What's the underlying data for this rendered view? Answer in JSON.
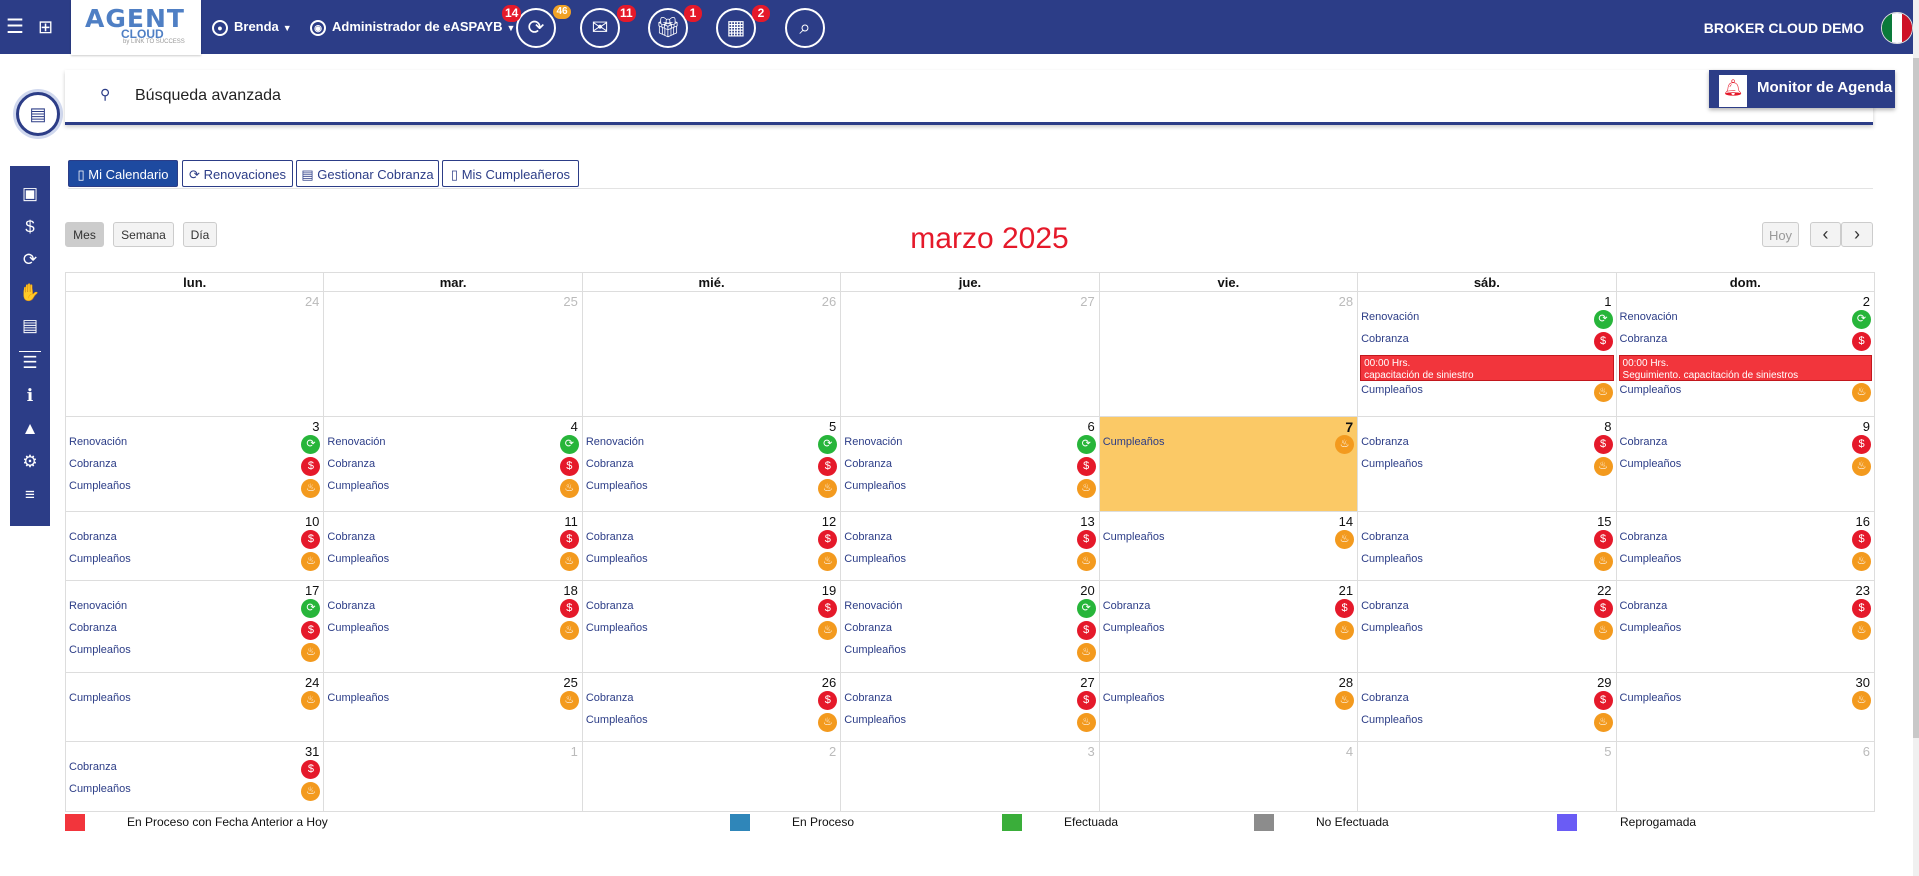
{
  "header": {
    "logo_main": "AGENT",
    "logo_sub": "CLOUD",
    "logo_tag": "by LINK TO SUCCESS",
    "user": "Brenda",
    "role": "Administrador de eASPAYB",
    "badges": {
      "contacts": "14",
      "contacts_secondary": "46",
      "mail": "11",
      "gifts": "1",
      "calendar": "2"
    },
    "brand": "BROKER CLOUD DEMO"
  },
  "search": {
    "placeholder": "Búsqueda avanzada"
  },
  "monitor": {
    "label": "Monitor de Agenda"
  },
  "tabs": [
    "Mi Calendario",
    "Renovaciones",
    "Gestionar Cobranza",
    "Mis Cumpleañeros"
  ],
  "views": [
    "Mes",
    "Semana",
    "Día"
  ],
  "nav": {
    "today": "Hoy",
    "prev": "‹",
    "next": "›"
  },
  "calendar": {
    "title": "marzo 2025",
    "weekdays": [
      "lun.",
      "mar.",
      "mié.",
      "jue.",
      "vie.",
      "sáb.",
      "dom."
    ],
    "weeks": [
      [
        {
          "day": "24",
          "off": true,
          "events": []
        },
        {
          "day": "25",
          "off": true,
          "events": []
        },
        {
          "day": "26",
          "off": true,
          "events": []
        },
        {
          "day": "27",
          "off": true,
          "events": []
        },
        {
          "day": "28",
          "off": true,
          "events": []
        },
        {
          "day": "1",
          "events": [
            {
              "t": "Renovación",
              "k": "ren"
            },
            {
              "t": "Cobranza",
              "k": "cob"
            },
            {
              "appt": [
                "00:00 Hrs.",
                "capacitación de siniestro"
              ]
            },
            {
              "t": "Cumpleaños",
              "k": "cum"
            }
          ]
        },
        {
          "day": "2",
          "events": [
            {
              "t": "Renovación",
              "k": "ren"
            },
            {
              "t": "Cobranza",
              "k": "cob"
            },
            {
              "appt": [
                "00:00 Hrs.",
                "Seguimiento. capacitación de siniestros"
              ]
            },
            {
              "t": "Cumpleaños",
              "k": "cum"
            }
          ]
        }
      ],
      [
        {
          "day": "3",
          "events": [
            {
              "t": "Renovación",
              "k": "ren"
            },
            {
              "t": "Cobranza",
              "k": "cob"
            },
            {
              "t": "Cumpleaños",
              "k": "cum"
            }
          ]
        },
        {
          "day": "4",
          "events": [
            {
              "t": "Renovación",
              "k": "ren"
            },
            {
              "t": "Cobranza",
              "k": "cob"
            },
            {
              "t": "Cumpleaños",
              "k": "cum"
            }
          ]
        },
        {
          "day": "5",
          "events": [
            {
              "t": "Renovación",
              "k": "ren"
            },
            {
              "t": "Cobranza",
              "k": "cob"
            },
            {
              "t": "Cumpleaños",
              "k": "cum"
            }
          ]
        },
        {
          "day": "6",
          "events": [
            {
              "t": "Renovación",
              "k": "ren"
            },
            {
              "t": "Cobranza",
              "k": "cob"
            },
            {
              "t": "Cumpleaños",
              "k": "cum"
            }
          ]
        },
        {
          "day": "7",
          "today": true,
          "events": [
            {
              "t": "Cumpleaños",
              "k": "cum"
            }
          ]
        },
        {
          "day": "8",
          "events": [
            {
              "t": "Cobranza",
              "k": "cob"
            },
            {
              "t": "Cumpleaños",
              "k": "cum"
            }
          ]
        },
        {
          "day": "9",
          "events": [
            {
              "t": "Cobranza",
              "k": "cob"
            },
            {
              "t": "Cumpleaños",
              "k": "cum"
            }
          ]
        }
      ],
      [
        {
          "day": "10",
          "events": [
            {
              "t": "Cobranza",
              "k": "cob"
            },
            {
              "t": "Cumpleaños",
              "k": "cum"
            }
          ]
        },
        {
          "day": "11",
          "events": [
            {
              "t": "Cobranza",
              "k": "cob"
            },
            {
              "t": "Cumpleaños",
              "k": "cum"
            }
          ]
        },
        {
          "day": "12",
          "events": [
            {
              "t": "Cobranza",
              "k": "cob"
            },
            {
              "t": "Cumpleaños",
              "k": "cum"
            }
          ]
        },
        {
          "day": "13",
          "events": [
            {
              "t": "Cobranza",
              "k": "cob"
            },
            {
              "t": "Cumpleaños",
              "k": "cum"
            }
          ]
        },
        {
          "day": "14",
          "events": [
            {
              "t": "Cumpleaños",
              "k": "cum"
            }
          ]
        },
        {
          "day": "15",
          "events": [
            {
              "t": "Cobranza",
              "k": "cob"
            },
            {
              "t": "Cumpleaños",
              "k": "cum"
            }
          ]
        },
        {
          "day": "16",
          "events": [
            {
              "t": "Cobranza",
              "k": "cob"
            },
            {
              "t": "Cumpleaños",
              "k": "cum"
            }
          ]
        }
      ],
      [
        {
          "day": "17",
          "events": [
            {
              "t": "Renovación",
              "k": "ren"
            },
            {
              "t": "Cobranza",
              "k": "cob"
            },
            {
              "t": "Cumpleaños",
              "k": "cum"
            }
          ]
        },
        {
          "day": "18",
          "events": [
            {
              "t": "Cobranza",
              "k": "cob"
            },
            {
              "t": "Cumpleaños",
              "k": "cum"
            }
          ]
        },
        {
          "day": "19",
          "events": [
            {
              "t": "Cobranza",
              "k": "cob"
            },
            {
              "t": "Cumpleaños",
              "k": "cum"
            }
          ]
        },
        {
          "day": "20",
          "events": [
            {
              "t": "Renovación",
              "k": "ren"
            },
            {
              "t": "Cobranza",
              "k": "cob"
            },
            {
              "t": "Cumpleaños",
              "k": "cum"
            }
          ]
        },
        {
          "day": "21",
          "events": [
            {
              "t": "Cobranza",
              "k": "cob"
            },
            {
              "t": "Cumpleaños",
              "k": "cum"
            }
          ]
        },
        {
          "day": "22",
          "events": [
            {
              "t": "Cobranza",
              "k": "cob"
            },
            {
              "t": "Cumpleaños",
              "k": "cum"
            }
          ]
        },
        {
          "day": "23",
          "events": [
            {
              "t": "Cobranza",
              "k": "cob"
            },
            {
              "t": "Cumpleaños",
              "k": "cum"
            }
          ]
        }
      ],
      [
        {
          "day": "24",
          "events": [
            {
              "t": "Cumpleaños",
              "k": "cum"
            }
          ]
        },
        {
          "day": "25",
          "events": [
            {
              "t": "Cumpleaños",
              "k": "cum"
            }
          ]
        },
        {
          "day": "26",
          "events": [
            {
              "t": "Cobranza",
              "k": "cob"
            },
            {
              "t": "Cumpleaños",
              "k": "cum"
            }
          ]
        },
        {
          "day": "27",
          "events": [
            {
              "t": "Cobranza",
              "k": "cob"
            },
            {
              "t": "Cumpleaños",
              "k": "cum"
            }
          ]
        },
        {
          "day": "28",
          "events": [
            {
              "t": "Cumpleaños",
              "k": "cum"
            }
          ]
        },
        {
          "day": "29",
          "events": [
            {
              "t": "Cobranza",
              "k": "cob"
            },
            {
              "t": "Cumpleaños",
              "k": "cum"
            }
          ]
        },
        {
          "day": "30",
          "events": [
            {
              "t": "Cumpleaños",
              "k": "cum"
            }
          ]
        }
      ],
      [
        {
          "day": "31",
          "events": [
            {
              "t": "Cobranza",
              "k": "cob"
            },
            {
              "t": "Cumpleaños",
              "k": "cum"
            }
          ]
        },
        {
          "day": "1",
          "off": true,
          "events": []
        },
        {
          "day": "2",
          "off": true,
          "events": []
        },
        {
          "day": "3",
          "off": true,
          "events": []
        },
        {
          "day": "4",
          "off": true,
          "events": []
        },
        {
          "day": "5",
          "off": true,
          "events": []
        },
        {
          "day": "6",
          "off": true,
          "events": []
        }
      ]
    ]
  },
  "event_icons": {
    "ren": "renew-icon",
    "cob": "collection-icon",
    "cum": "birthday-cake-icon"
  },
  "legend": [
    {
      "label": "En Proceso con Fecha Anterior a Hoy",
      "color": "#f2353c"
    },
    {
      "label": "En Proceso",
      "color": "#2f86b9"
    },
    {
      "label": "Efectuada",
      "color": "#3aae3a"
    },
    {
      "label": "No Efectuada",
      "color": "#8c8c8c"
    },
    {
      "label": "Reprogamada",
      "color": "#6a5cf5"
    }
  ],
  "colors": {
    "header_bg": "#2c3d87",
    "title": "#e5192a",
    "today_bg": "#fbc966"
  }
}
